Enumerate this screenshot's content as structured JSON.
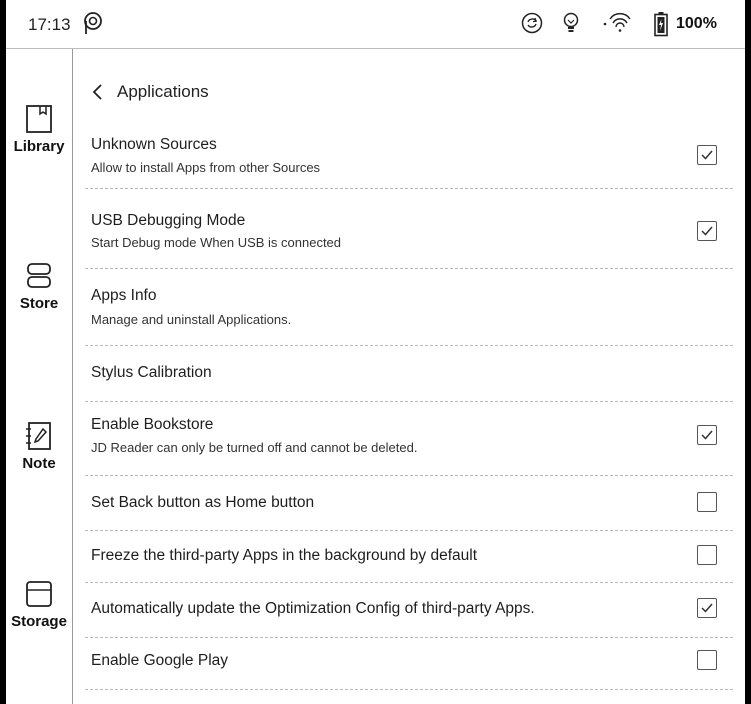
{
  "status_bar": {
    "time": "17:13",
    "battery": "100%",
    "icons": [
      "pocket-icon",
      "sync-icon",
      "lightbulb-icon",
      "wifi-icon",
      "battery-icon"
    ]
  },
  "sidebar": {
    "items": [
      {
        "label": "Library",
        "icon": "book-icon"
      },
      {
        "label": "Store",
        "icon": "store-icon"
      },
      {
        "label": "Note",
        "icon": "note-icon"
      },
      {
        "label": "Storage",
        "icon": "storage-icon"
      }
    ]
  },
  "header": {
    "title": "Applications",
    "back_icon": "chevron-left-icon"
  },
  "settings": [
    {
      "title": "Unknown Sources",
      "subtitle": "Allow to install Apps from other Sources",
      "checked": true
    },
    {
      "title": "USB Debugging Mode",
      "subtitle": "Start Debug mode When USB is connected",
      "checked": true
    },
    {
      "title": "Apps Info",
      "subtitle": "Manage and uninstall Applications."
    },
    {
      "title": "Stylus Calibration"
    },
    {
      "title": "Enable Bookstore",
      "subtitle": "JD Reader can only be turned off and cannot be deleted.",
      "checked": true
    },
    {
      "title": "Set Back button as Home button",
      "checked": false
    },
    {
      "title": "Freeze the third-party Apps in the background by default",
      "checked": false
    },
    {
      "title": "Automatically update the Optimization Config of third-party Apps.",
      "checked": true
    },
    {
      "title": "Enable Google Play",
      "checked": false
    }
  ]
}
